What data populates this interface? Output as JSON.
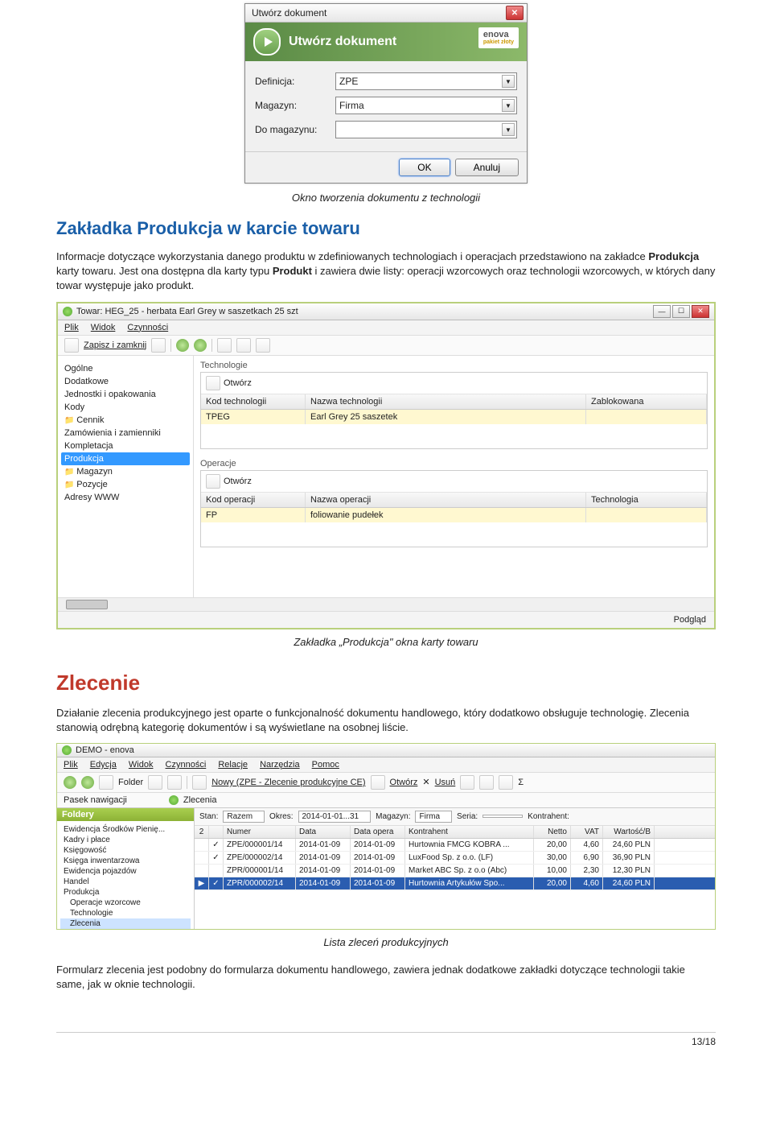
{
  "dialog": {
    "title": "Utwórz dokument",
    "banner_title": "Utwórz dokument",
    "logo_text": "enova",
    "logo_sub": "pakiet złoty",
    "fields": {
      "definicja_label": "Definicja:",
      "definicja_value": "ZPE",
      "magazyn_label": "Magazyn:",
      "magazyn_value": "Firma",
      "domagazynu_label": "Do magazynu:",
      "domagazynu_value": ""
    },
    "ok": "OK",
    "cancel": "Anuluj"
  },
  "caption1": "Okno tworzenia dokumentu z technologii",
  "section1": {
    "heading": "Zakładka Produkcja w karcie towaru",
    "para_parts": {
      "p1": "Informacje dotyczące wykorzystania danego produktu w zdefiniowanych technologiach i operacjach przedstawiono na zakładce ",
      "b1": "Produkcja",
      "p2": " karty towaru. Jest ona dostępna dla karty typu ",
      "b2": "Produkt",
      "p3": " i zawiera dwie listy: operacji wzorcowych oraz technologii wzorcowych, w których dany towar występuje jako produkt."
    }
  },
  "towar_window": {
    "title": "Towar: HEG_25 - herbata Earl Grey w saszetkach 25 szt",
    "menu": {
      "plik": "Plik",
      "widok": "Widok",
      "czynnosci": "Czynności"
    },
    "toolbar": {
      "save_close": "Zapisz i zamknij"
    },
    "sidebar": [
      "Ogólne",
      "Dodatkowe",
      "Jednostki i opakowania",
      "Kody",
      "Cennik",
      "Zamówienia i zamienniki",
      "Kompletacja",
      "Produkcja",
      "Magazyn",
      "Pozycje",
      "Adresy WWW"
    ],
    "tech_group": "Technologie",
    "tech_open": "Otwórz",
    "tech_cols": {
      "kod": "Kod technologii",
      "nazwa": "Nazwa technologii",
      "zab": "Zablokowana"
    },
    "tech_row": {
      "kod": "TPEG",
      "nazwa": "Earl Grey 25 saszetek",
      "zab": ""
    },
    "op_group": "Operacje",
    "op_open": "Otwórz",
    "op_cols": {
      "kod": "Kod operacji",
      "nazwa": "Nazwa operacji",
      "tech": "Technologia"
    },
    "op_row": {
      "kod": "FP",
      "nazwa": "foliowanie pudełek",
      "tech": ""
    },
    "footer": "Podgląd"
  },
  "caption2": "Zakładka „Produkcja\" okna karty towaru",
  "section2": {
    "heading": "Zlecenie",
    "para": "Działanie zlecenia produkcyjnego jest oparte o funkcjonalność dokumentu handlowego, który dodatkowo obsługuje technologię. Zlecenia stanowią odrębną kategorię dokumentów i są wyświetlane na osobnej liście."
  },
  "demo_window": {
    "title": "DEMO - enova",
    "menu": {
      "plik": "Plik",
      "edycja": "Edycja",
      "widok": "Widok",
      "czynnosci": "Czynności",
      "relacje": "Relacje",
      "narzedzia": "Narzędzia",
      "pomoc": "Pomoc"
    },
    "toolbar": {
      "folder": "Folder",
      "nowy": "Nowy (ZPE - Zlecenie produkcyjne CE)",
      "otworz": "Otwórz",
      "usun": "Usuń"
    },
    "nav_label": "Pasek nawigacji",
    "breadcrumb": "Zlecenia",
    "folders_label": "Foldery",
    "filters": {
      "stan_l": "Stan:",
      "stan_v": "Razem",
      "okres_l": "Okres:",
      "okres_v": "2014-01-01...31",
      "magazyn_l": "Magazyn:",
      "magazyn_v": "Firma",
      "seria_l": "Seria:",
      "seria_v": "",
      "kontrahent_l": "Kontrahent:"
    },
    "tree": [
      "Ewidencja Środków Pienię...",
      "Kadry i płace",
      "Księgowość",
      "Księga inwentarzowa",
      "Ewidencja pojazdów",
      "Handel",
      "Produkcja",
      "Operacje wzorcowe",
      "Technologie",
      "Zlecenia"
    ],
    "grid_cols": {
      "chk": "2",
      "numer": "Numer",
      "data": "Data",
      "dataop": "Data opera",
      "kontr": "Kontrahent",
      "netto": "Netto",
      "vat": "VAT",
      "wart": "Wartość/B"
    },
    "rows": [
      {
        "chk": "✓",
        "numer": "ZPE/000001/14",
        "data": "2014-01-09",
        "dataop": "2014-01-09",
        "kontr": "Hurtownia FMCG KOBRA ...",
        "netto": "20,00",
        "vat": "4,60",
        "wart": "24,60 PLN"
      },
      {
        "chk": "✓",
        "numer": "ZPE/000002/14",
        "data": "2014-01-09",
        "dataop": "2014-01-09",
        "kontr": "LuxFood Sp. z o.o. (LF)",
        "netto": "30,00",
        "vat": "6,90",
        "wart": "36,90 PLN"
      },
      {
        "chk": "",
        "numer": "ZPR/000001/14",
        "data": "2014-01-09",
        "dataop": "2014-01-09",
        "kontr": "Market ABC Sp. z o.o (Abc)",
        "netto": "10,00",
        "vat": "2,30",
        "wart": "12,30 PLN"
      },
      {
        "chk": "✓",
        "numer": "ZPR/000002/14",
        "data": "2014-01-09",
        "dataop": "2014-01-09",
        "kontr": "Hurtownia Artykułów Spo...",
        "netto": "20,00",
        "vat": "4,60",
        "wart": "24,60 PLN"
      }
    ]
  },
  "caption3": "Lista zleceń produkcyjnych",
  "para3": "Formularz zlecenia jest podobny do formularza dokumentu handlowego, zawiera jednak dodatkowe zakładki dotyczące technologii takie same, jak w oknie technologii.",
  "pagenum": "13/18"
}
